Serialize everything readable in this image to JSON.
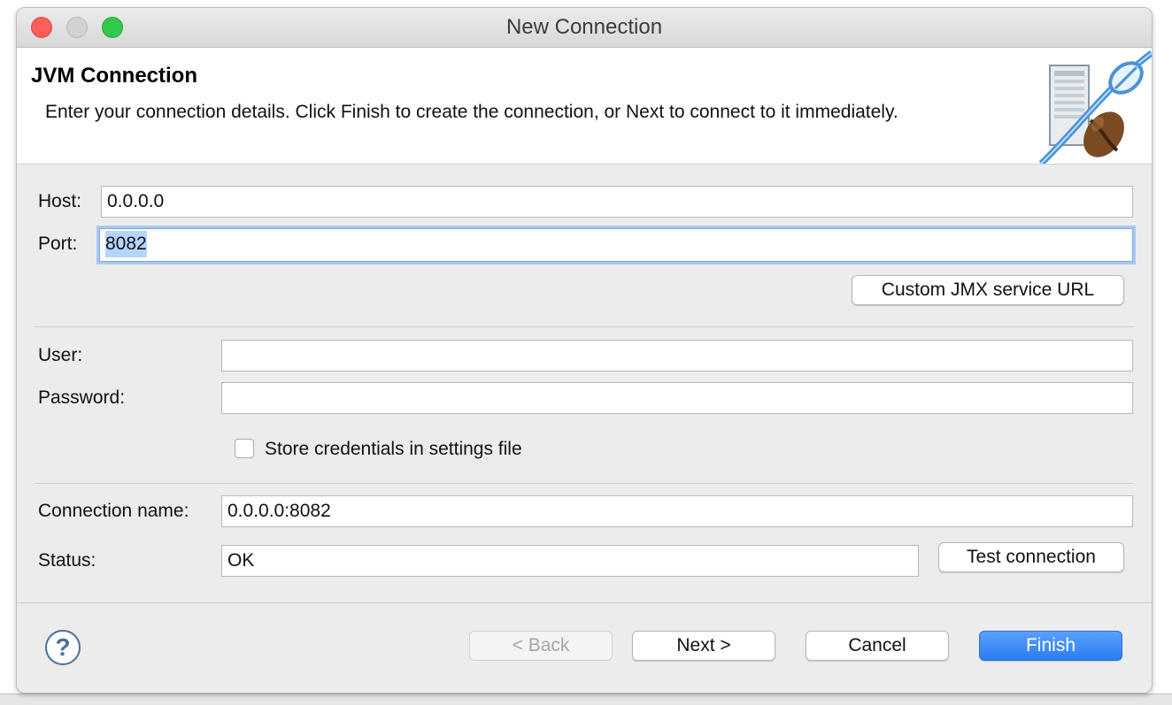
{
  "window": {
    "title": "New Connection"
  },
  "banner": {
    "title": "JVM Connection",
    "description": "Enter your connection details. Click Finish to create the connection, or Next to connect to it immediately.",
    "icon": "jvm-server-coffee-bean-icon"
  },
  "host": {
    "label": "Host:",
    "value": "0.0.0.0"
  },
  "port": {
    "label": "Port:",
    "value": "8082"
  },
  "custom_jmx_button": "Custom JMX service URL",
  "user": {
    "label": "User:",
    "value": ""
  },
  "password": {
    "label": "Password:",
    "value": ""
  },
  "store_credentials": {
    "label": "Store credentials in settings file",
    "checked": false
  },
  "connection_name": {
    "label": "Connection name:",
    "value": "0.0.0.0:8082"
  },
  "status": {
    "label": "Status:",
    "value": "OK"
  },
  "test_connection_button": "Test connection",
  "footer": {
    "help_icon": "help-icon",
    "help_glyph": "?",
    "back": "< Back",
    "next": "Next >",
    "cancel": "Cancel",
    "finish": "Finish"
  },
  "colors": {
    "accent": "#2b7cf3",
    "focus_ring": "#a9c7f2",
    "selection": "#b4d5fe"
  }
}
